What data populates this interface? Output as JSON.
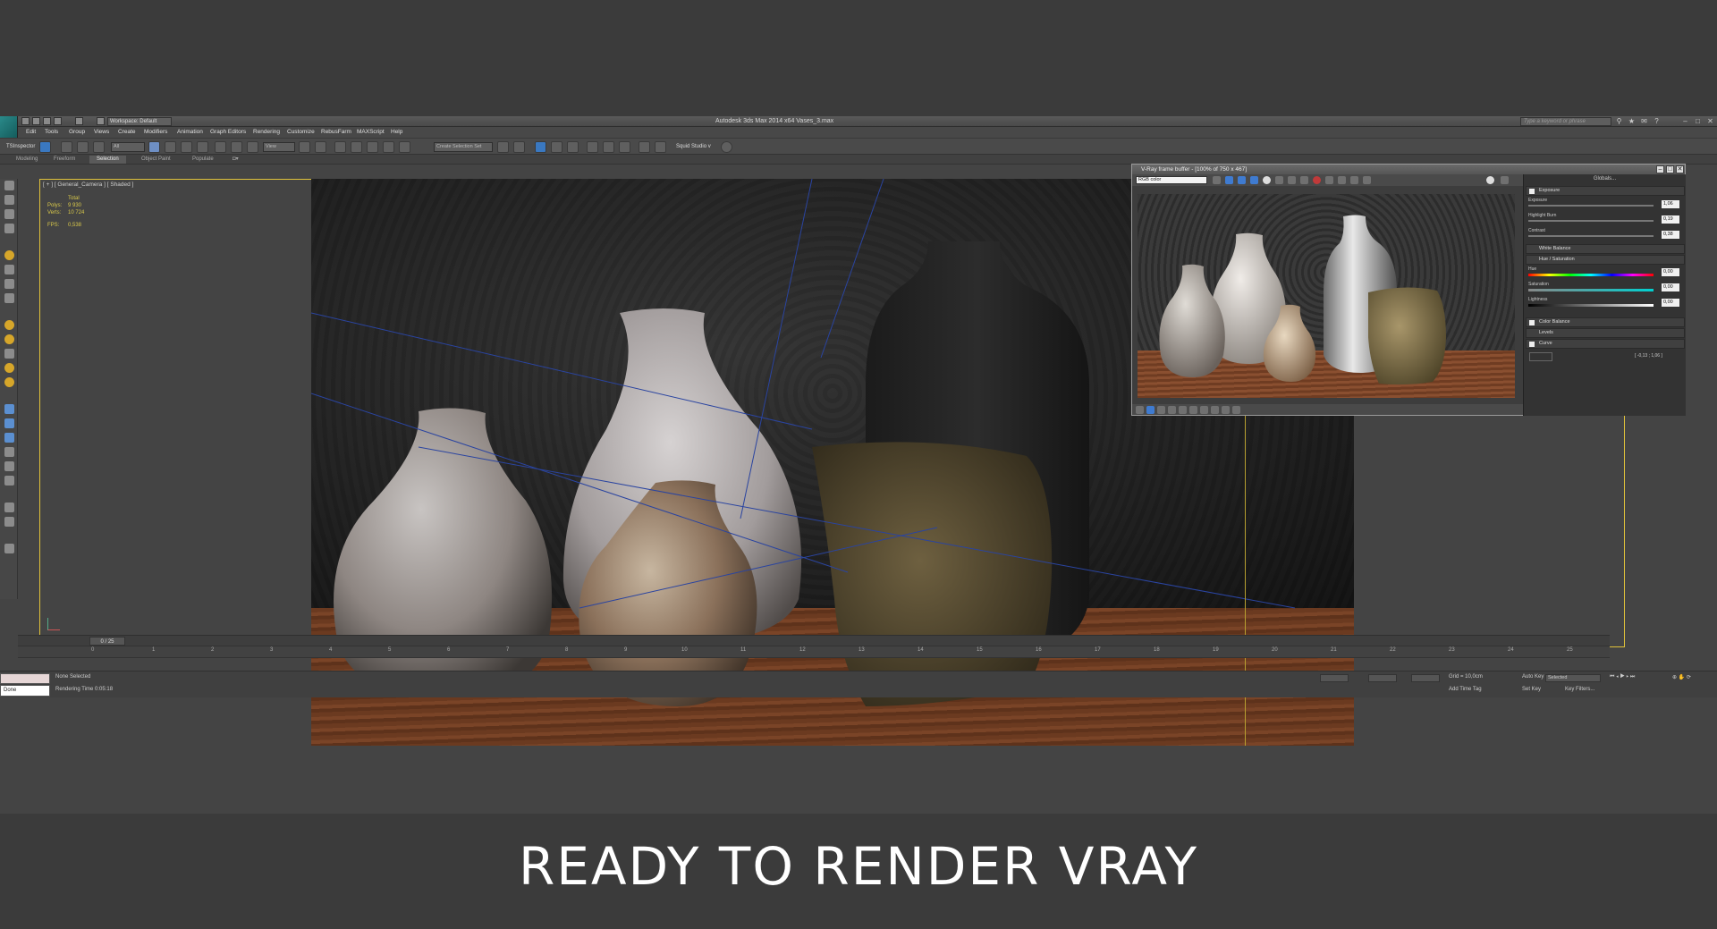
{
  "window": {
    "title": "Autodesk 3ds Max 2014 x64    Vases_3.max",
    "workspace": "Workspace: Default",
    "search_placeholder": "Type a keyword or phrase"
  },
  "menu": [
    "Edit",
    "Tools",
    "Group",
    "Views",
    "Create",
    "Modifiers",
    "Animation",
    "Graph Editors",
    "Rendering",
    "Customize",
    "RebusFarm",
    "MAXScript",
    "Help"
  ],
  "toolbar": {
    "ts_label": "TSInspector",
    "filter_select": "All",
    "view_select": "View",
    "selection_set": "Create Selection Set",
    "squid": "Squid Studio v"
  },
  "ribbon_tabs": [
    "Modeling",
    "Freeform",
    "Selection",
    "Object Paint",
    "Populate"
  ],
  "viewport": {
    "label": "[ + ] [ General_Camera ] [ Shaded ]",
    "stats_total": "Total",
    "polys_label": "Polys:",
    "polys_value": "9 930",
    "verts_label": "Verts:",
    "verts_value": "10 724",
    "fps_label": "FPS:",
    "fps_value": "0,538"
  },
  "timeline": {
    "frame_counter": "0 / 25",
    "ticks": [
      "0",
      "1",
      "2",
      "3",
      "4",
      "5",
      "6",
      "7",
      "8",
      "9",
      "10",
      "11",
      "12",
      "13",
      "14",
      "15",
      "16",
      "17",
      "18",
      "19",
      "20",
      "21",
      "22",
      "23",
      "24",
      "25"
    ]
  },
  "status": {
    "selection": "None Selected",
    "render_time": "Rendering Time  0:05:18",
    "done": "Done",
    "grid": "Grid = 10,0cm",
    "add_time_tag": "Add Time Tag",
    "auto_key": "Auto Key",
    "set_key": "Set Key",
    "key_mode": "Selected",
    "key_filters": "Key Filters..."
  },
  "vfb": {
    "title": "V-Ray frame buffer - [100% of 750 x 467]",
    "channel": "RGB color",
    "globals": "Globals...",
    "exposure": "Exposure",
    "exposure_label": "Exposure",
    "exposure_value": "1,06",
    "highlight_label": "Highlight Burn",
    "highlight_value": "0,19",
    "contrast_label": "Contrast",
    "contrast_value": "0,38",
    "white_balance": "White Balance",
    "hue_sat": "Hue / Saturation",
    "hue_label": "Hue",
    "hue_value": "0,00",
    "sat_label": "Saturation",
    "sat_value": "0,00",
    "light_label": "Lightness",
    "light_value": "0,00",
    "color_balance": "Color Balance",
    "levels": "Levels",
    "curve": "Curve",
    "curve_readout": "[ -0,13 ; 1,06 ]"
  },
  "caption": "READY TO RENDER  VRAY"
}
